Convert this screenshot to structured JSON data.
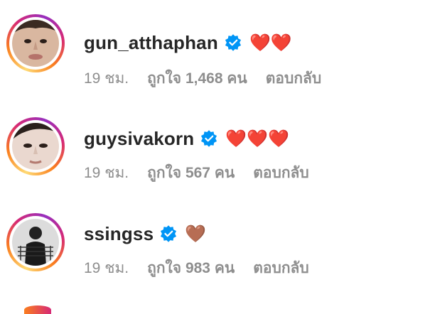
{
  "comments": [
    {
      "username": "gun_atthaphan",
      "emoji": "❤️❤️",
      "time": "19 ชม.",
      "likes": "ถูกใจ 1,468 คน",
      "reply": "ตอบกลับ"
    },
    {
      "username": "guysivakorn",
      "emoji": "❤️❤️❤️",
      "time": "19 ชม.",
      "likes": "ถูกใจ 567 คน",
      "reply": "ตอบกลับ"
    },
    {
      "username": "ssingss",
      "emoji": "🤎",
      "time": "19 ชม.",
      "likes": "ถูกใจ 983 คน",
      "reply": "ตอบกลับ"
    }
  ],
  "colors": {
    "verified": "#0095f6",
    "heart": "#ed4956",
    "brown_heart": "#8b5a2b",
    "meta_text": "#8e8e8e",
    "username_text": "#262626"
  },
  "icons": {
    "verified": "verified-badge-icon",
    "avatar": "profile-photo"
  }
}
